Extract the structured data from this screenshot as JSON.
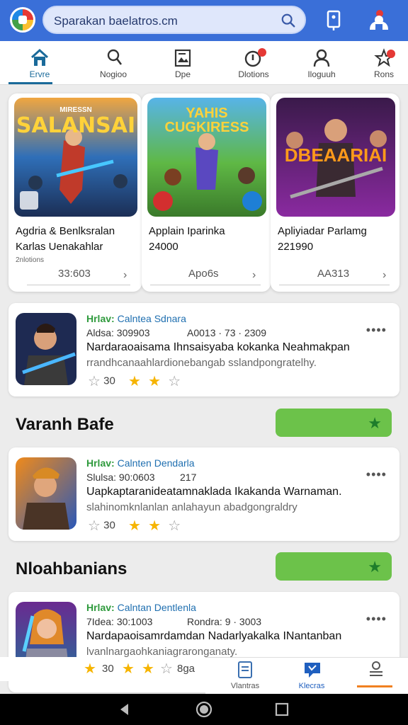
{
  "header": {
    "search_text": "Sparakan baelatros.cm",
    "colors": {
      "bar": "#3a6fd8",
      "search_bg": "#dfe7fb"
    }
  },
  "tabs": [
    {
      "label": "Ervre",
      "icon": "home-icon",
      "active": true
    },
    {
      "label": "Nogioo",
      "icon": "user-icon"
    },
    {
      "label": "Dpe",
      "icon": "image-icon"
    },
    {
      "label": "Dlotions",
      "icon": "alert-icon"
    },
    {
      "label": "Iloguuh",
      "icon": "person-icon"
    },
    {
      "label": "Rons",
      "icon": "star-outline-icon"
    }
  ],
  "featured": [
    {
      "art_text": "SALANSAI",
      "art_small": "MIRESSN",
      "title_line1": "Agdria & Benlksralan",
      "title_line2": "Karlas Uenakahlar",
      "subtitle": "2nlotions",
      "price": "33:603"
    },
    {
      "art_text": "YAHIS CUGKIRESS",
      "title_line1": "Applain Iparinka",
      "title_line2": "24000",
      "price": "Apo6s"
    },
    {
      "art_text": "DBEAARIAI",
      "title_line1": "Apliyiadar Parlamg",
      "title_line2": "221990",
      "price": "AA313"
    }
  ],
  "items": [
    {
      "title_tag": "Hrlav:",
      "title_rest": "Calntea Sdnara",
      "meta1": "Aldsa: 309903",
      "meta2": "A0013 · 73 · 2309",
      "desc": "Nardaraoaisama Ihnsaisyaba kokanka Neahmakpan",
      "desc2": "rrandhcanaahlardionebangab sslandpongratelhy.",
      "rating": "30",
      "stars": 2,
      "stars_total": 3
    },
    {
      "title_tag": "Hrlav:",
      "title_rest": "Calnten Dendarla",
      "meta1": "Slulsa: 90:0603",
      "meta2": "217",
      "desc": "Uapkaptaranideatamnaklada Ikakanda Warnaman.",
      "desc2": "slahinomknlanlan anlahayun abadgongraldry",
      "rating": "30",
      "stars": 2,
      "stars_total": 3
    },
    {
      "title_tag": "Hrlav:",
      "title_rest": "Calntan Dentlenla",
      "meta1": "7Idea: 30:1003",
      "meta2": "Rondra: 9 · 3003",
      "desc": "Nardapaoisamrdamdan Nadarlyakalka INantanban",
      "desc2": "lvanlnargaohkaniagraronganaty.",
      "rating": "30",
      "stars": 2,
      "stars_total": 3,
      "extra": "8ga"
    }
  ],
  "sections": [
    {
      "title": "Varanh Bafe"
    },
    {
      "title": "Nloahbanians"
    }
  ],
  "bottom_nav": [
    {
      "label": "Vlantras",
      "icon": "document-icon"
    },
    {
      "label": "Klecras",
      "icon": "chat-icon",
      "active": true
    },
    {
      "label": "",
      "icon": "stack-icon"
    }
  ]
}
